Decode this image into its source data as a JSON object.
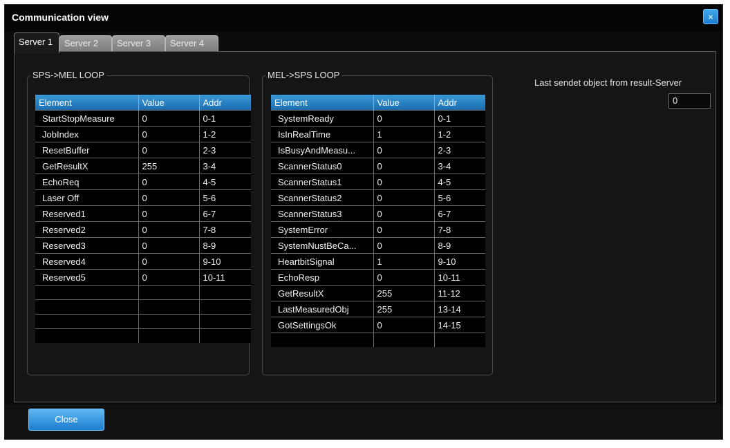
{
  "window": {
    "title": "Communication view",
    "close_glyph": "×"
  },
  "tabs": [
    "Server 1",
    "Server 2",
    "Server 3",
    "Server 4"
  ],
  "sps_group": {
    "title": "SPS->MEL LOOP",
    "headers": [
      "Element",
      "Value",
      "Addr"
    ],
    "rows": [
      [
        "StartStopMeasure",
        "0",
        "0-1"
      ],
      [
        "JobIndex",
        "0",
        "1-2"
      ],
      [
        "ResetBuffer",
        "0",
        "2-3"
      ],
      [
        "GetResultX",
        "255",
        "3-4"
      ],
      [
        "EchoReq",
        "0",
        "4-5"
      ],
      [
        "Laser Off",
        "0",
        "5-6"
      ],
      [
        "Reserved1",
        "0",
        "6-7"
      ],
      [
        "Reserved2",
        "0",
        "7-8"
      ],
      [
        "Reserved3",
        "0",
        "8-9"
      ],
      [
        "Reserved4",
        "0",
        "9-10"
      ],
      [
        "Reserved5",
        "0",
        "10-11"
      ]
    ]
  },
  "mel_group": {
    "title": "MEL->SPS LOOP",
    "headers": [
      "Element",
      "Value",
      "Addr"
    ],
    "rows": [
      [
        "SystemReady",
        "0",
        "0-1"
      ],
      [
        "IsInRealTime",
        "1",
        "1-2"
      ],
      [
        "IsBusyAndMeasu...",
        "0",
        "2-3"
      ],
      [
        "ScannerStatus0",
        "0",
        "3-4"
      ],
      [
        "ScannerStatus1",
        "0",
        "4-5"
      ],
      [
        "ScannerStatus2",
        "0",
        "5-6"
      ],
      [
        "ScannerStatus3",
        "0",
        "6-7"
      ],
      [
        "SystemError",
        "0",
        "7-8"
      ],
      [
        "SystemNustBeCa...",
        "0",
        "8-9"
      ],
      [
        "HeartbitSignal",
        "1",
        "9-10"
      ],
      [
        "EchoResp",
        "0",
        "10-11"
      ],
      [
        "GetResultX",
        "255",
        "11-12"
      ],
      [
        "LastMeasuredObj",
        "255",
        "13-14"
      ],
      [
        "GotSettingsOk",
        "0",
        "14-15"
      ]
    ]
  },
  "last_sent": {
    "label": "Last sendet object from result-Server",
    "value": "0"
  },
  "footer": {
    "close_label": "Close"
  },
  "colors": {
    "accent": "#1d7ccf",
    "background": "#151515"
  }
}
